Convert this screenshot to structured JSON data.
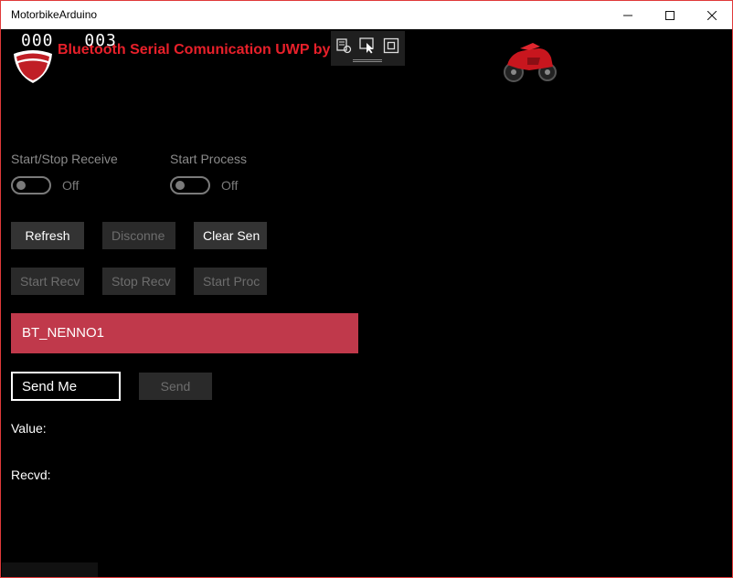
{
  "window": {
    "title": "MotorbikeArduino"
  },
  "header": {
    "title": "Bluetooth Serial Comunication UWP by",
    "counter_left": "000",
    "counter_right": "003",
    "accent_color": "#e8202a"
  },
  "toggles": {
    "receive": {
      "label": "Start/Stop Receive",
      "state": "Off"
    },
    "process": {
      "label": "Start Process",
      "state": "Off"
    }
  },
  "buttons": {
    "refresh": "Refresh",
    "disconnect": "Disconne",
    "clear_send": "Clear Sen",
    "start_recv": "Start Recv",
    "stop_recv": "Stop Recv",
    "start_process": "Start Proc",
    "send": "Send"
  },
  "devices": [
    {
      "name": "BT_NENNO1",
      "color": "#c0394b"
    }
  ],
  "send_input": {
    "value": "Send Me"
  },
  "labels": {
    "value": "Value:",
    "recvd": "Recvd:"
  },
  "icons": {
    "logo": "ducati-shield-icon",
    "bike": "motorbike-icon",
    "debug": [
      "live-visual-tree-icon",
      "select-element-icon",
      "display-layout-adorners-icon"
    ]
  }
}
